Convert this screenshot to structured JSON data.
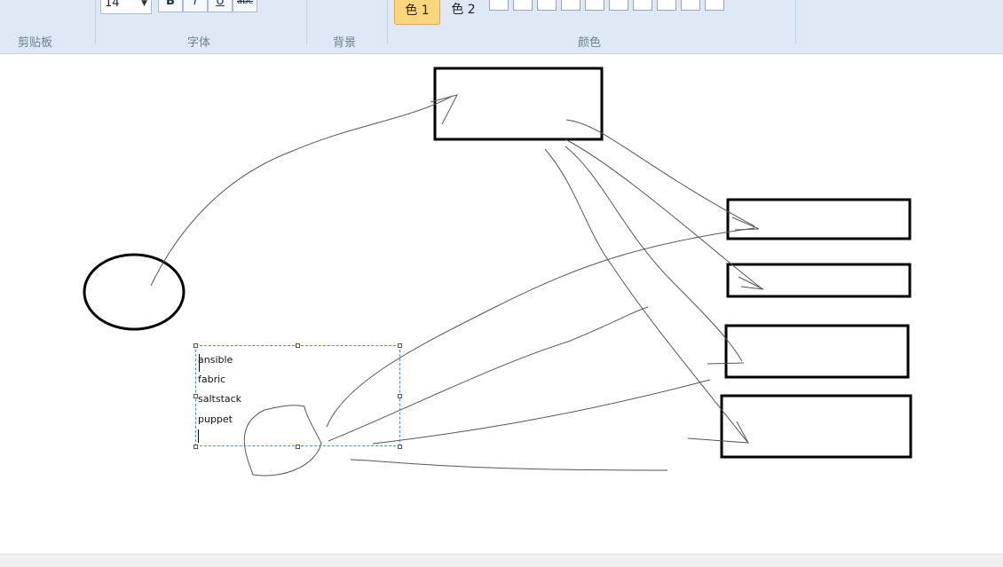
{
  "ribbon": {
    "groups": {
      "clipboard": "剪贴板",
      "font": "字体",
      "background": "背景",
      "colors": "颜色"
    },
    "font_size": "14",
    "format_buttons": {
      "bold": "B",
      "italic": "I",
      "underline": "U",
      "strike": "abc"
    },
    "color1_label": "色 1",
    "color2_label": "色 2",
    "accent": "#fbd67c"
  },
  "canvas": {
    "text_box_lines": [
      "ansible",
      "fabric",
      "saltstack",
      "puppet"
    ]
  }
}
